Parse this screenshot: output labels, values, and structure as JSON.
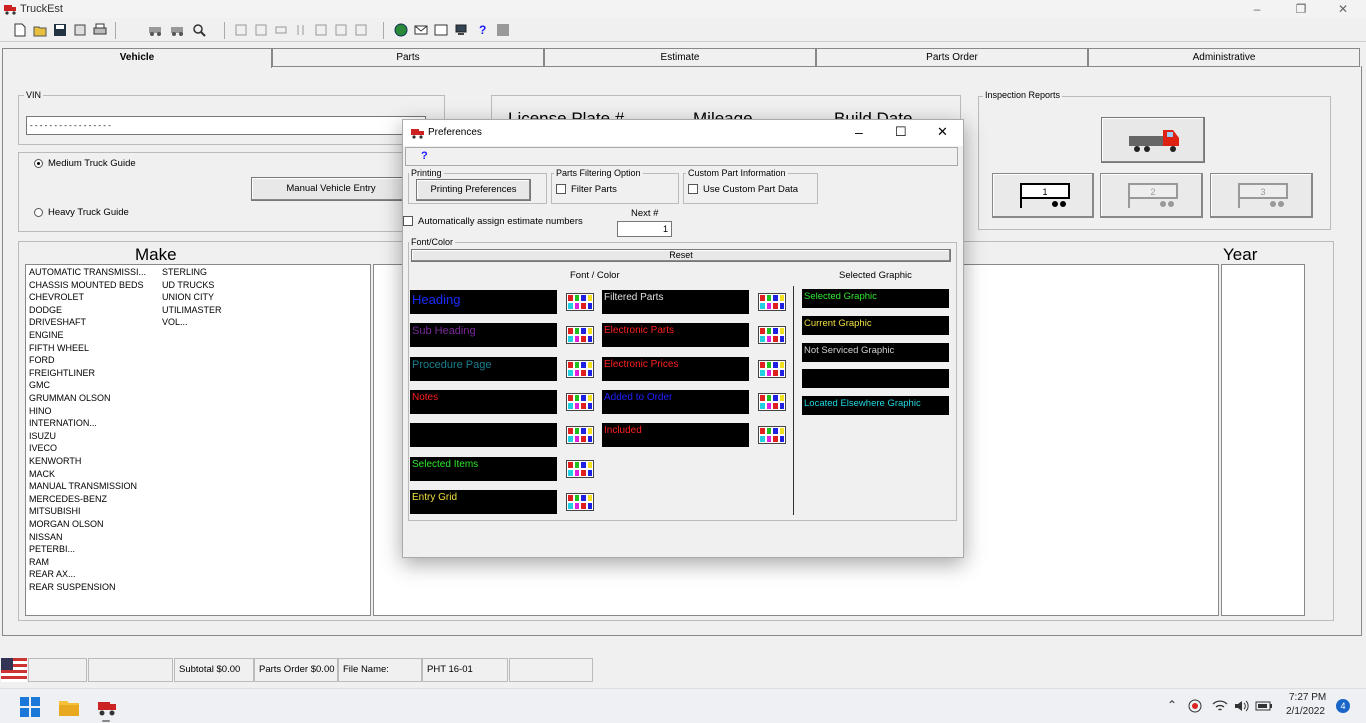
{
  "window": {
    "title": "TruckEst",
    "minimize": "–",
    "maximize": "❐",
    "close": "✕"
  },
  "tabs": [
    "Vehicle",
    "Parts",
    "Estimate",
    "Parts Order",
    "Administrative"
  ],
  "vehicle": {
    "vin_label": "VIN",
    "vin_value": "- - - - - - - - - - - - - - - - -",
    "license_label": "License Plate #",
    "mileage_label": "Mileage",
    "build_label": "Build Date",
    "medium_guide": "Medium Truck Guide",
    "heavy_guide": "Heavy Truck Guide",
    "manual_entry": "Manual Vehicle Entry",
    "inspection_label": "Inspection Reports",
    "trailers": [
      "1",
      "2",
      "3"
    ],
    "make_title": "Make",
    "year_title": "Year",
    "makes_col1": [
      "AUTOMATIC TRANSMISSI...",
      "CHASSIS MOUNTED BEDS",
      "CHEVROLET",
      "DODGE",
      "DRIVESHAFT",
      "ENGINE",
      "FIFTH WHEEL",
      "FORD",
      "FREIGHTLINER",
      "GMC",
      "GRUMMAN OLSON",
      "HINO",
      "INTERNATION...",
      "ISUZU",
      "IVECO",
      "KENWORTH",
      "MACK",
      "MANUAL TRANSMISSION",
      "MERCEDES-BENZ",
      "MITSUBISHI",
      "MORGAN OLSON",
      "NISSAN",
      "PETERBI...",
      "RAM",
      "REAR AX...",
      "REAR SUSPENSION"
    ],
    "makes_col2": [
      "STERLING",
      "UD TRUCKS",
      "UNION CITY",
      "UTILIMASTER",
      "VOL..."
    ]
  },
  "status": {
    "subtotal": "Subtotal $0.00",
    "parts_order": "Parts Order $0.00",
    "file_name": "File Name:",
    "file_value": "PHT 16-01"
  },
  "taskbar": {
    "time": "7:27 PM",
    "date": "2/1/2022",
    "badge": "4"
  },
  "dialog": {
    "title": "Preferences",
    "help": "?",
    "printing_label": "Printing",
    "printing_button": "Printing Preferences",
    "filter_label": "Parts Filtering Option",
    "filter_check": "Filter Parts",
    "custom_label": "Custom Part Information",
    "custom_check": "Use Custom Part Data",
    "auto_assign": "Automatically assign estimate numbers",
    "next_label": "Next #",
    "next_value": "1",
    "fontcolor_label": "Font/Color",
    "reset": "Reset",
    "col_fontcolor": "Font / Color",
    "col_graphic": "Selected Graphic",
    "left_boxes": [
      {
        "text": "Heading",
        "color": "#1a2bff"
      },
      {
        "text": "Sub Heading",
        "color": "#7b2a9a"
      },
      {
        "text": "Procedure Page",
        "color": "#1a7f8f"
      },
      {
        "text": "Notes",
        "color": "#ff2020"
      },
      {
        "text": "",
        "color": "#ffffff"
      },
      {
        "text": "Selected Items",
        "color": "#2ee82e"
      },
      {
        "text": "Entry Grid",
        "color": "#f0e040"
      }
    ],
    "mid_boxes": [
      {
        "text": "Filtered Parts",
        "color": "#e0e0e0"
      },
      {
        "text": "Electronic Parts",
        "color": "#ff2020"
      },
      {
        "text": "Electronic Prices",
        "color": "#ff2020"
      },
      {
        "text": "Added to Order",
        "color": "#2020ff"
      },
      {
        "text": "Included",
        "color": "#ff2020"
      }
    ],
    "graphic_boxes": [
      {
        "text": "Selected Graphic",
        "color": "#2ee82e"
      },
      {
        "text": "Current Graphic",
        "color": "#f0e040"
      },
      {
        "text": "Not Serviced Graphic",
        "color": "#d0d0d0"
      },
      {
        "text": "",
        "color": "#ffffff"
      },
      {
        "text": "Located Elsewhere Graphic",
        "color": "#20d8e0"
      }
    ]
  }
}
